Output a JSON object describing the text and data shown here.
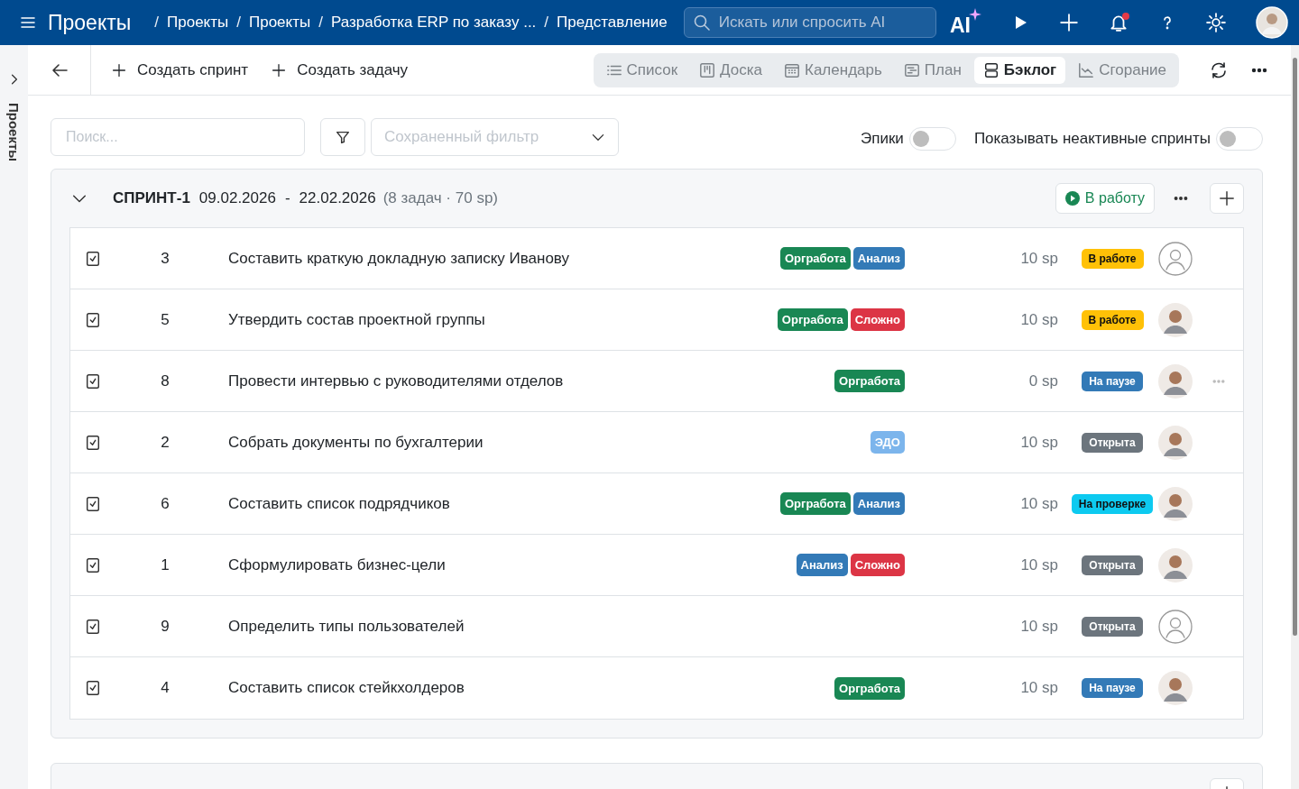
{
  "topbar": {
    "app_title": "Проекты",
    "separator": "/",
    "breadcrumbs": [
      "Проекты",
      "Проекты",
      "Разработка ERP по заказу ...",
      "Представление"
    ],
    "search": {
      "placeholder": "Искать или спросить AI"
    },
    "ai_label": "AI",
    "notifications_unread": true
  },
  "side_rail": {
    "label": "Проекты"
  },
  "toolbar": {
    "actions": [
      "Создать спринт",
      "Создать задачу"
    ],
    "views": [
      {
        "label": "Список",
        "selected": false
      },
      {
        "label": "Доска",
        "selected": false
      },
      {
        "label": "Календарь",
        "selected": false
      },
      {
        "label": "План",
        "selected": false
      },
      {
        "label": "Бэклог",
        "selected": true
      },
      {
        "label": "Сгорание",
        "selected": false
      }
    ]
  },
  "filters": {
    "search": {
      "placeholder": "Поиск..."
    },
    "saved_filter": {
      "placeholder": "Сохраненный фильтр"
    },
    "toggles": [
      {
        "label": "Эпики",
        "on": false
      },
      {
        "label": "Показывать неактивные спринты",
        "on": false
      }
    ]
  },
  "sprint": {
    "name": "СПРИНТ-1",
    "start": "09.02.2026",
    "dash": "-",
    "end": "22.02.2026",
    "summary": "(8 задач · 70 sp)",
    "expanded": true,
    "start_button": "В работу",
    "tasks": [
      {
        "number": "3",
        "title": "Составить краткую докладную записку Иванову",
        "tags": [
          {
            "label": "Оргработа",
            "color": "#198754"
          },
          {
            "label": "Анализ",
            "color": "#337ab7"
          }
        ],
        "points": "10 sp",
        "status": {
          "label": "В работе",
          "kind": "progress"
        },
        "assigned": false,
        "menu_visible": false
      },
      {
        "number": "5",
        "title": "Утвердить состав проектной группы",
        "tags": [
          {
            "label": "Оргработа",
            "color": "#198754"
          },
          {
            "label": "Сложно",
            "color": "#dc3545"
          }
        ],
        "points": "10 sp",
        "status": {
          "label": "В работе",
          "kind": "progress"
        },
        "assigned": true,
        "menu_visible": false
      },
      {
        "number": "8",
        "title": "Провести интервью с руководителями отделов",
        "tags": [
          {
            "label": "Оргработа",
            "color": "#198754"
          }
        ],
        "points": "0 sp",
        "status": {
          "label": "На паузе",
          "kind": "paused"
        },
        "assigned": true,
        "menu_visible": true
      },
      {
        "number": "2",
        "title": "Собрать документы по бухгалтерии",
        "tags": [
          {
            "label": "ЭДО",
            "color": "#7cb5ec"
          }
        ],
        "points": "10 sp",
        "status": {
          "label": "Открыта",
          "kind": "open"
        },
        "assigned": true,
        "menu_visible": false
      },
      {
        "number": "6",
        "title": "Составить список подрядчиков",
        "tags": [
          {
            "label": "Оргработа",
            "color": "#198754"
          },
          {
            "label": "Анализ",
            "color": "#337ab7"
          }
        ],
        "points": "10 sp",
        "status": {
          "label": "На проверке",
          "kind": "review"
        },
        "assigned": true,
        "menu_visible": false
      },
      {
        "number": "1",
        "title": "Сформулировать бизнес-цели",
        "tags": [
          {
            "label": "Анализ",
            "color": "#337ab7"
          },
          {
            "label": "Сложно",
            "color": "#dc3545"
          }
        ],
        "points": "10 sp",
        "status": {
          "label": "Открыта",
          "kind": "open"
        },
        "assigned": true,
        "menu_visible": false
      },
      {
        "number": "9",
        "title": "Определить типы пользователей",
        "points": "10 sp",
        "status": {
          "label": "Открыта",
          "kind": "open"
        },
        "assigned": false,
        "menu_visible": false
      },
      {
        "number": "4",
        "title": "Составить список стейкхолдеров",
        "tags": [
          {
            "label": "Оргработа",
            "color": "#198754"
          }
        ],
        "points": "10 sp",
        "status": {
          "label": "На паузе",
          "kind": "paused"
        },
        "assigned": true,
        "menu_visible": false
      }
    ]
  }
}
